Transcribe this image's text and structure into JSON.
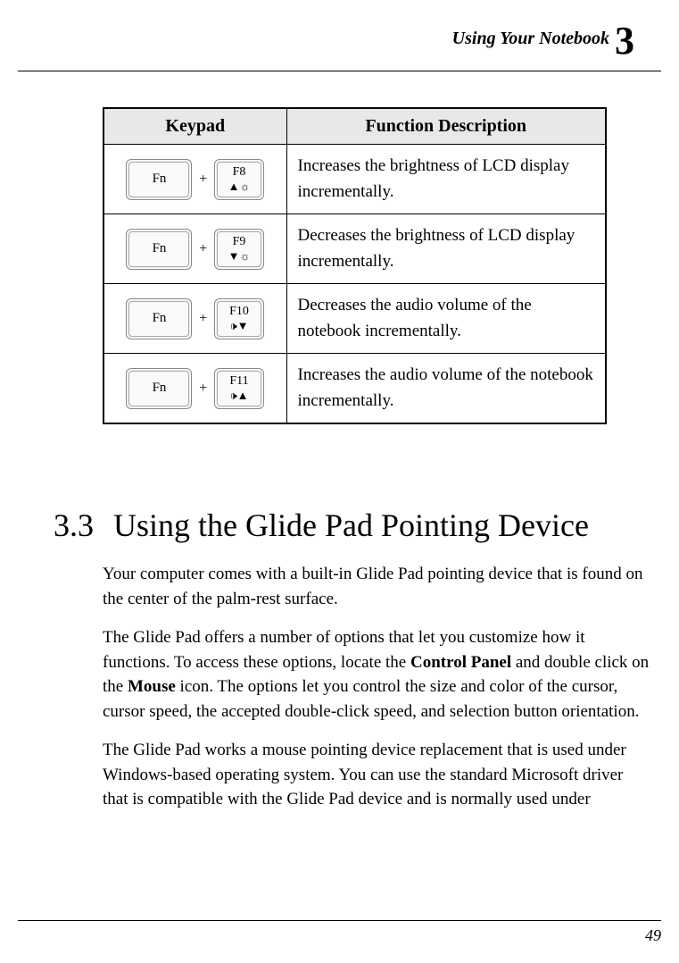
{
  "header": {
    "title": "Using Your Notebook",
    "chapter": "3"
  },
  "table": {
    "headers": {
      "keypad": "Keypad",
      "desc": "Function Description"
    },
    "rows": [
      {
        "fn": "Fn",
        "key": "F8",
        "icon": "▲☼",
        "desc": "Increases the brightness of LCD display incrementally."
      },
      {
        "fn": "Fn",
        "key": "F9",
        "icon": "▼☼",
        "desc": "Decreases the brightness of LCD display incrementally."
      },
      {
        "fn": "Fn",
        "key": "F10",
        "icon": "🕩▼",
        "desc": "Decreases the audio volume of the notebook incrementally."
      },
      {
        "fn": "Fn",
        "key": "F11",
        "icon": "🕩▲",
        "desc": "Increases the audio volume of the notebook incrementally."
      }
    ],
    "plus": "+"
  },
  "section": {
    "number": "3.3",
    "title": "Using the Glide Pad Pointing Device"
  },
  "paragraphs": {
    "p1": "Your computer comes with a built-in Glide Pad pointing device that is found on the center of the palm-rest surface.",
    "p2a": "The Glide Pad offers a number of options that let you customize how it functions. To access these options, locate the ",
    "p2b": "Control Panel",
    "p2c": " and double click on the ",
    "p2d": "Mouse",
    "p2e": " icon. The options let you control the size and color of the cursor, cursor speed, the accepted double-click speed, and selection button orientation.",
    "p3": "The Glide Pad works a mouse pointing device replacement that is used under Windows-based operating system. You can use the standard Microsoft driver that is compatible with the Glide Pad device and is normally used under"
  },
  "page_number": "49"
}
